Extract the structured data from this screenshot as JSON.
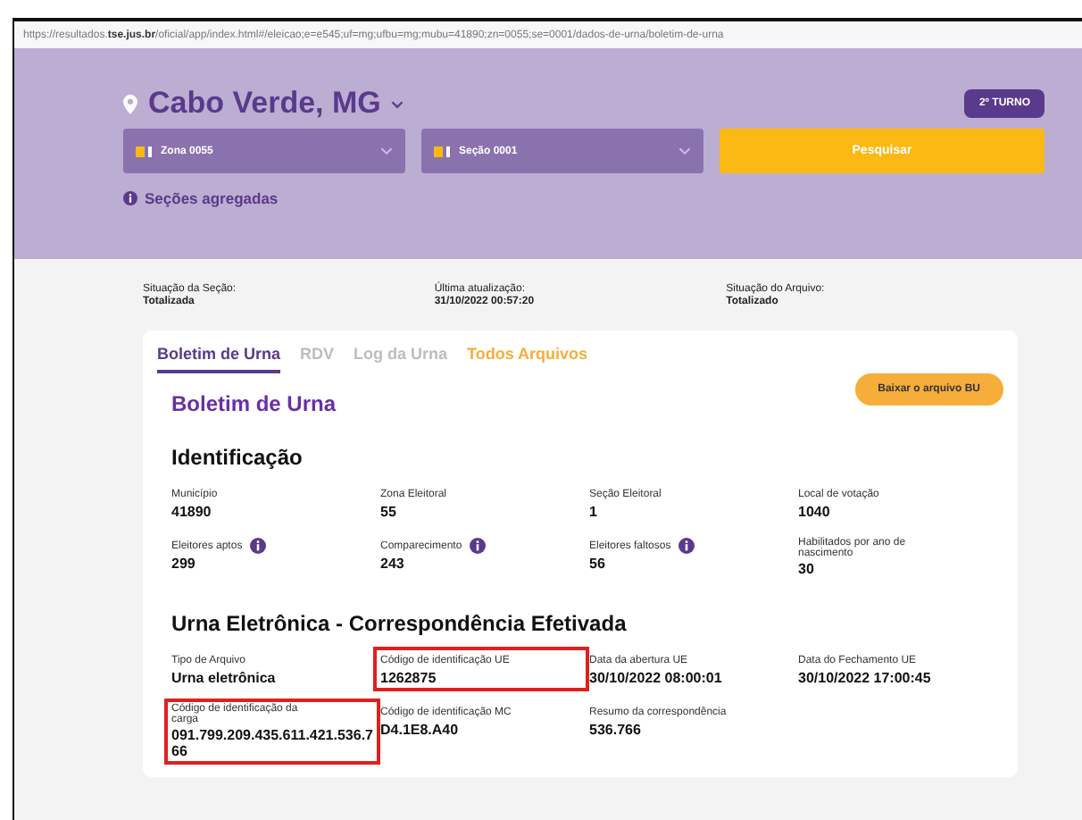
{
  "address_bar": {
    "url": "https://resultados.**tse.jus.br**/oficial/app/index.html#/eleicao;e=e545;uf=mg;ufbu=mg;mubu=41890;zn=0055;se=0001/dados-de-urna/boletim-de-urna"
  },
  "header": {
    "location": "Cabo Verde, MG",
    "round_button": "2º TURNO",
    "selects": [
      {
        "value": "Zona 0055"
      },
      {
        "value": "Seção 0001"
      }
    ],
    "search_button": "Pesquisar",
    "aggregated_link": "Seções agregadas"
  },
  "status": [
    {
      "label": "Situação da Seção:",
      "value": "Totalizada"
    },
    {
      "label": "Última atualização:",
      "value": "31/10/2022 00:57:20"
    },
    {
      "label": "Situação do Arquivo:",
      "value": "Totalizado"
    }
  ],
  "tabs": [
    {
      "label": "Boletim de Urna",
      "selected": true,
      "kind": "normal"
    },
    {
      "label": "RDV",
      "selected": false,
      "kind": "normal"
    },
    {
      "label": "Log da Urna",
      "selected": false,
      "kind": "normal"
    },
    {
      "label": "Todos Arquivos",
      "selected": false,
      "kind": "accent"
    }
  ],
  "card_title": "Boletim de Urna",
  "download_button": "Baixar o arquivo BU",
  "sections": [
    {
      "title": "Identificação",
      "fields": [
        {
          "label": "Município",
          "value": "41890",
          "info": false,
          "highlighted": false
        },
        {
          "label": "Zona Eleitoral",
          "value": "55",
          "info": false,
          "highlighted": false
        },
        {
          "label": "Seção Eleitoral",
          "value": "1",
          "info": false,
          "highlighted": false
        },
        {
          "label": "Local de votação",
          "value": "1040",
          "info": false,
          "highlighted": false
        },
        {
          "label": "Eleitores aptos",
          "value": "299",
          "info": true,
          "highlighted": false
        },
        {
          "label": "Comparecimento",
          "value": "243",
          "info": true,
          "highlighted": false
        },
        {
          "label": "Eleitores faltosos",
          "value": "56",
          "info": true,
          "highlighted": false
        },
        {
          "label": "Habilitados por ano de nascimento",
          "value": "30",
          "info": false,
          "highlighted": false
        }
      ]
    },
    {
      "title": "Urna Eletrônica - Correspondência Efetivada",
      "fields": [
        {
          "label": "Tipo de Arquivo",
          "value": "Urna eletrônica",
          "info": false,
          "highlighted": false
        },
        {
          "label": "Código de identificação UE",
          "value": "1262875",
          "info": false,
          "highlighted": true
        },
        {
          "label": "Data da abertura UE",
          "value": "30/10/2022 08:00:01",
          "info": false,
          "highlighted": false
        },
        {
          "label": "Data do Fechamento UE",
          "value": "30/10/2022 17:00:45",
          "info": false,
          "highlighted": false
        },
        {
          "label": "Código de identificação da carga",
          "value": "091.799.209.435.611.421.536.766",
          "info": false,
          "highlighted": true
        },
        {
          "label": "Código de identificação MC",
          "value": "D4.1E8.A40",
          "info": false,
          "highlighted": false
        },
        {
          "label": "Resumo da correspondência",
          "value": "536.766",
          "info": false,
          "highlighted": false
        }
      ]
    }
  ]
}
